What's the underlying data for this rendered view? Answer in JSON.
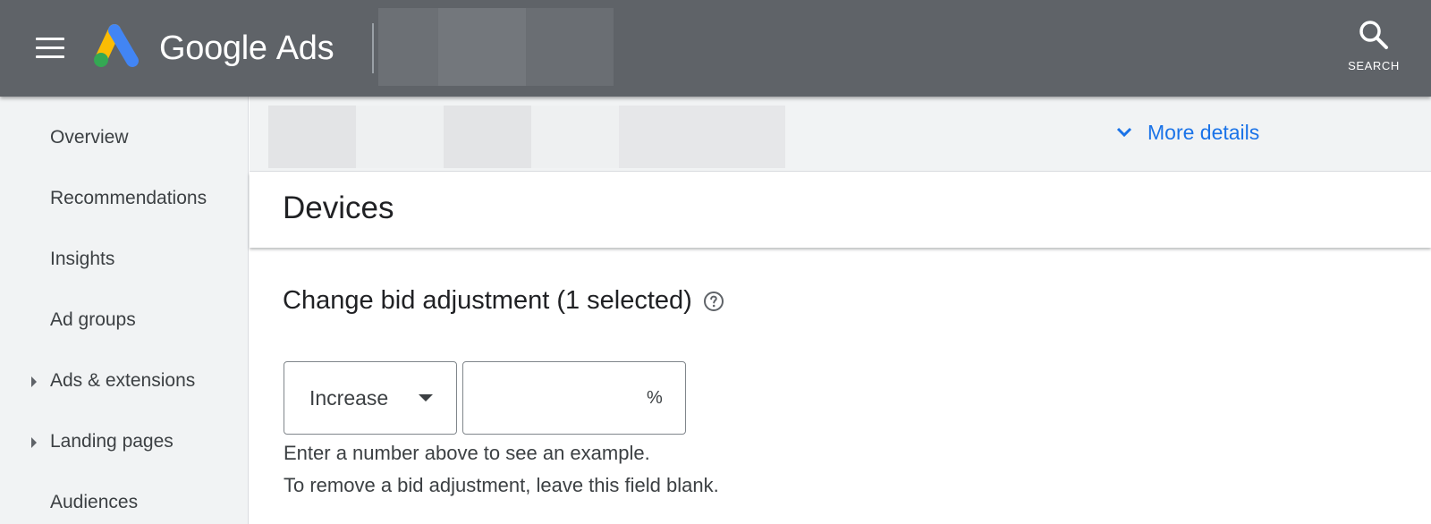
{
  "header": {
    "brand_google": "Google",
    "brand_ads": "Ads",
    "search_label": "SEARCH",
    "icons": [
      "menu-icon",
      "google-ads-logo",
      "search-icon"
    ]
  },
  "sidebar": {
    "items": [
      {
        "label": "Overview",
        "expandable": false
      },
      {
        "label": "Recommendations",
        "expandable": false
      },
      {
        "label": "Insights",
        "expandable": false
      },
      {
        "label": "Ad groups",
        "expandable": false
      },
      {
        "label": "Ads & extensions",
        "expandable": true
      },
      {
        "label": "Landing pages",
        "expandable": true
      },
      {
        "label": "Audiences",
        "expandable": false
      }
    ]
  },
  "summary": {
    "more_details_label": "More details"
  },
  "devices": {
    "title": "Devices"
  },
  "bid_adjustment": {
    "title": "Change bid adjustment (1 selected)",
    "direction_value": "Increase",
    "percent_value": "",
    "percent_suffix": "%",
    "hint_line1": "Enter a number above to see an example.",
    "hint_line2": "To remove a bid adjustment, leave this field blank."
  },
  "colors": {
    "topbar": "#5f6368",
    "sidebar_bg": "#f1f3f4",
    "link_blue": "#1a73e8",
    "logo_blue": "#4285f4",
    "logo_yellow": "#fbbc04",
    "logo_green": "#34a853"
  }
}
